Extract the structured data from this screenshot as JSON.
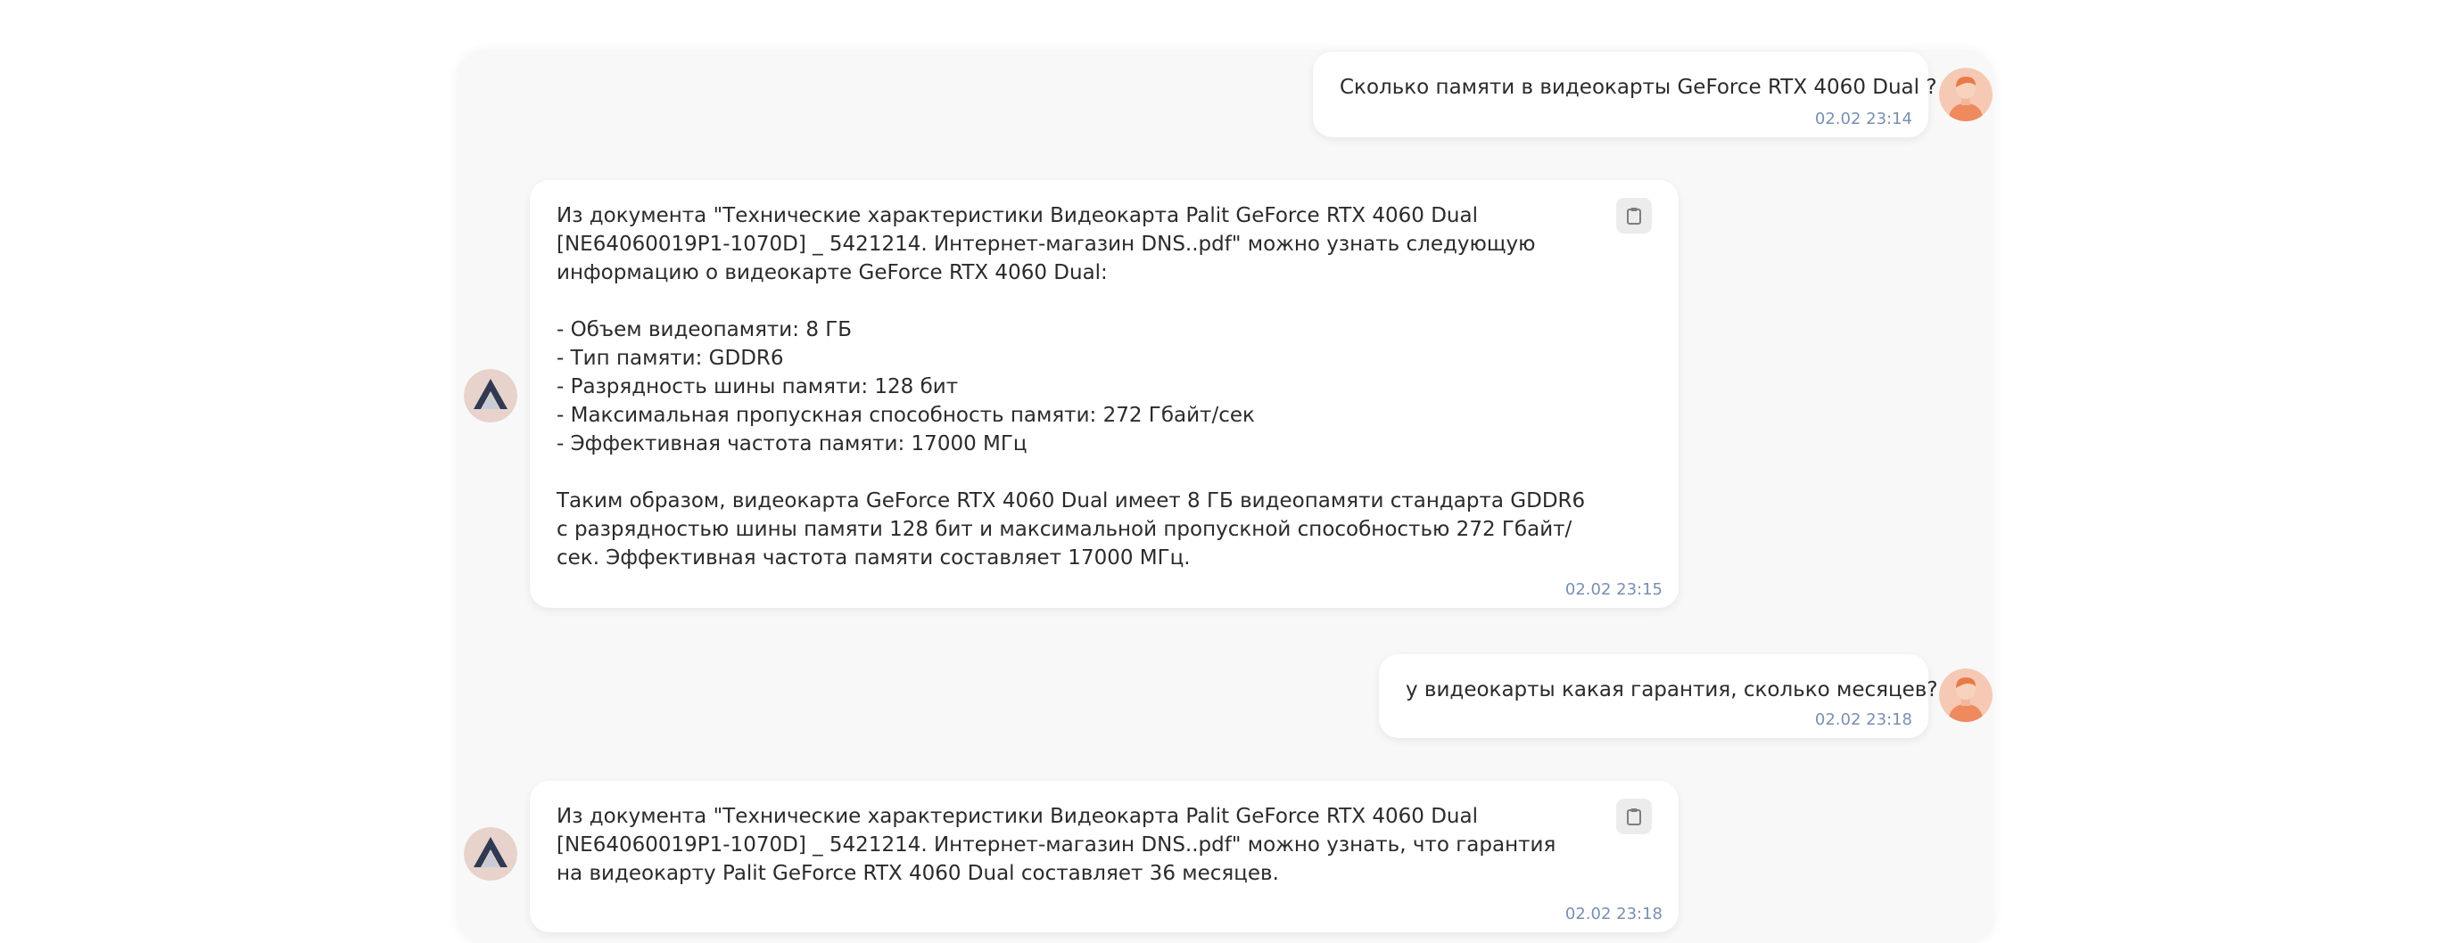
{
  "messages": [
    {
      "role": "user",
      "text": "Сколько памяти в видеокарты GeForce RTX 4060 Dual ?",
      "time": "02.02 23:14",
      "avatar": "user-avatar-icon"
    },
    {
      "role": "assistant",
      "text": "Из документа \"Технические характеристики Видеокарта Palit GeForce RTX 4060 Dual [NE64060019P1-1070D] _ 5421214. Интернет-магазин DNS..pdf\" можно узнать следующую информацию о видеокарте GeForce RTX 4060 Dual:\n\n- Объем видеопамяти: 8 ГБ\n- Тип памяти: GDDR6\n- Разрядность шины памяти: 128 бит\n- Максимальная пропускная способность памяти: 272 Гбайт/сек\n- Эффективная частота памяти: 17000 МГц\n\nТаким образом, видеокарта GeForce RTX 4060 Dual имеет 8 ГБ видеопамяти стандарта GDDR6 с разрядностью шины памяти 128 бит и максимальной пропускной способностью 272 Гбайт/сек. Эффективная частота памяти составляет 17000 МГц.",
      "time": "02.02 23:15",
      "avatar": "bot-avatar-icon",
      "copy_icon": "clipboard-icon"
    },
    {
      "role": "user",
      "text": "у видеокарты какая гарантия, сколько месяцев?",
      "time": "02.02 23:18",
      "avatar": "user-avatar-icon"
    },
    {
      "role": "assistant",
      "text": "Из документа \"Технические характеристики Видеокарта Palit GeForce RTX 4060 Dual [NE64060019P1-1070D] _ 5421214. Интернет-магазин DNS..pdf\" можно узнать, что гарантия на видеокарту Palit GeForce RTX 4060 Dual составляет 36 месяцев.",
      "time": "02.02 23:18",
      "avatar": "bot-avatar-icon",
      "copy_icon": "clipboard-icon"
    }
  ],
  "colors": {
    "panel_background": "#f8f8f8",
    "bubble_background": "#ffffff",
    "timestamp": "#7a8fb0",
    "user_avatar_bg": "#f6c9b4",
    "user_avatar_shirt": "#ef8a5f",
    "bot_avatar_bg": "#e7d3cc",
    "bot_avatar_logo": "#2f3a52"
  }
}
